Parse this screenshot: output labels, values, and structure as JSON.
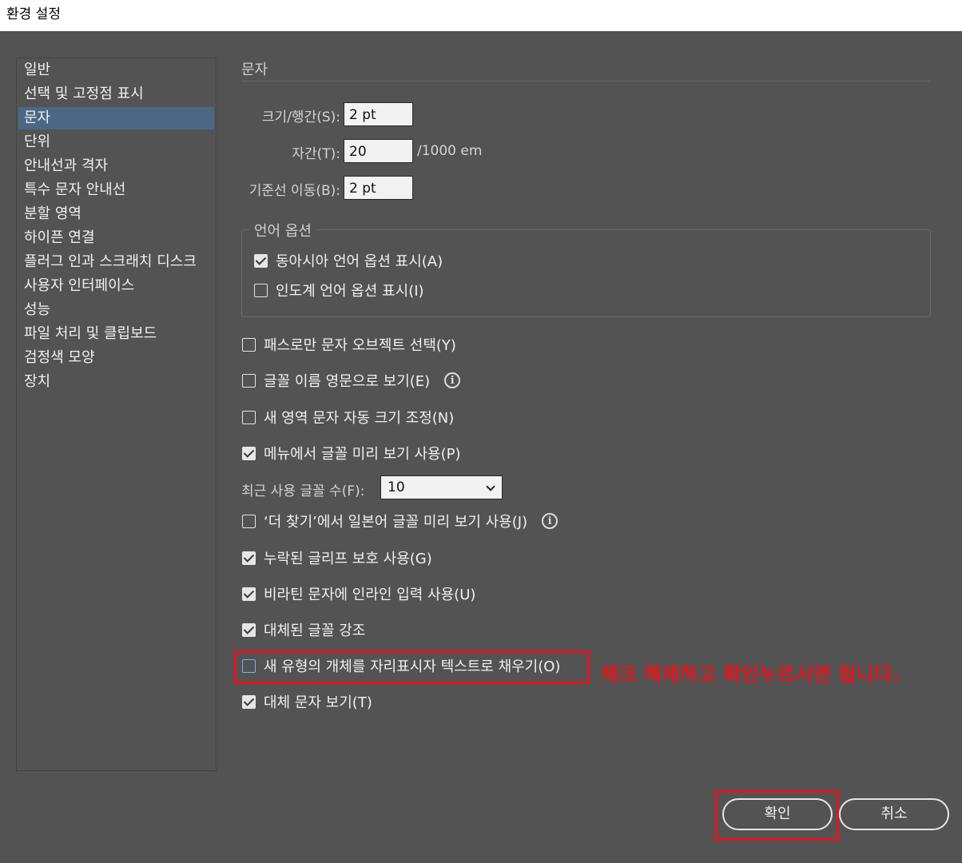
{
  "window": {
    "title": "환경 설정"
  },
  "sidebar": {
    "items": [
      {
        "label": "일반"
      },
      {
        "label": "선택 및 고정점 표시"
      },
      {
        "label": "문자",
        "active": true
      },
      {
        "label": "단위"
      },
      {
        "label": "안내선과 격자"
      },
      {
        "label": "특수 문자 안내선"
      },
      {
        "label": "분할 영역"
      },
      {
        "label": "하이픈 연결"
      },
      {
        "label": "플러그 인과 스크래치 디스크"
      },
      {
        "label": "사용자 인터페이스"
      },
      {
        "label": "성능"
      },
      {
        "label": "파일 처리 및 클립보드"
      },
      {
        "label": "검정색 모양"
      },
      {
        "label": "장치"
      }
    ]
  },
  "panel": {
    "title": "문자",
    "size_leading": {
      "label": "크기/행간(S):",
      "value": "2 pt"
    },
    "tracking": {
      "label": "자간(T):",
      "value": "20",
      "unit": "/1000 em"
    },
    "baseline_shift": {
      "label": "기준선 이동(B):",
      "value": "2 pt"
    },
    "language_options": {
      "legend": "언어 옵션",
      "east_asian": {
        "label": "동아시아 언어 옵션 표시(A)",
        "checked": true
      },
      "indic": {
        "label": "인도계 언어 옵션 표시(I)",
        "checked": false
      }
    },
    "options": [
      {
        "label": "패스로만 문자 오브젝트 선택(Y)",
        "checked": false
      },
      {
        "label": "글꼴 이름 영문으로 보기(E)",
        "checked": false,
        "info": true
      },
      {
        "label": "새 영역 문자 자동 크기 조정(N)",
        "checked": false
      },
      {
        "label": "메뉴에서 글꼴 미리 보기 사용(P)",
        "checked": true
      }
    ],
    "recent_fonts": {
      "label": "최근 사용 글꼴 수(F):",
      "value": "10"
    },
    "options2": [
      {
        "label": "‘더 찾기’에서 일본어 글꼴 미리 보기 사용(J)",
        "checked": false,
        "info": true
      },
      {
        "label": "누락된 글리프 보호 사용(G)",
        "checked": true
      },
      {
        "label": "비라틴 문자에 인라인 입력 사용(U)",
        "checked": true
      },
      {
        "label": "대체된 글꼴 강조",
        "checked": true
      },
      {
        "label": "새 유형의 개체를 자리표시자 텍스트로 채우기(O)",
        "checked": false
      },
      {
        "label": "대체 문자 보기(T)",
        "checked": true
      }
    ],
    "annotation": "체크 해제하고 확인누르시면 됩니다."
  },
  "buttons": {
    "ok": "확인",
    "cancel": "취소"
  },
  "colors": {
    "background": "#535353",
    "highlight": "#e8141c",
    "selection": "#4b6785"
  }
}
